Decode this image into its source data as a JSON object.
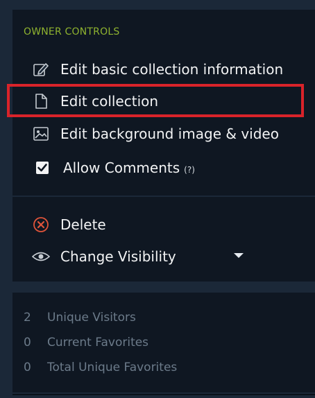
{
  "owner_controls": {
    "title": "OWNER CONTROLS",
    "items": [
      {
        "label": "Edit basic collection information",
        "icon": "edit-pencil-icon"
      },
      {
        "label": "Edit collection",
        "icon": "document-icon"
      },
      {
        "label": "Edit background image & video",
        "icon": "image-icon"
      }
    ],
    "allow_comments": {
      "label": "Allow Comments",
      "help": "(?)",
      "checked": true
    }
  },
  "actions": {
    "delete_label": "Delete",
    "visibility_label": "Change Visibility"
  },
  "stats": [
    {
      "value": "2",
      "label": "Unique Visitors"
    },
    {
      "value": "0",
      "label": "Current Favorites"
    },
    {
      "value": "0",
      "label": "Total Unique Favorites"
    }
  ],
  "colors": {
    "background": "#1b2838",
    "panel": "#0f1722",
    "accent_green": "#8fb32f",
    "highlight_red": "#d9232a"
  }
}
